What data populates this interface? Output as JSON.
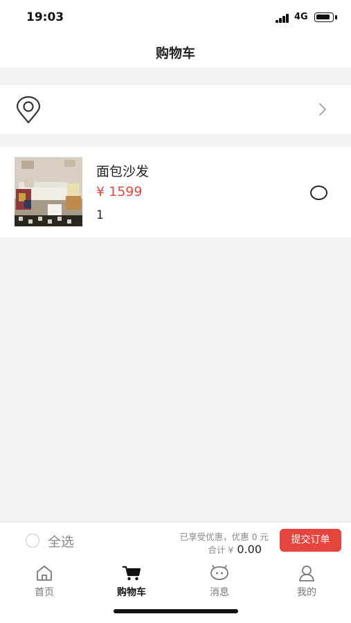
{
  "status_bar": {
    "time": "19:03",
    "network": "4G"
  },
  "nav": {
    "title": "购物车"
  },
  "address": {},
  "cart": {
    "items": [
      {
        "name": "面包沙发",
        "price": "¥ 1599",
        "quantity": "1"
      }
    ]
  },
  "footer": {
    "select_all_label": "全选",
    "discount_text": "已享受优惠，优惠 0 元",
    "total_label": "合计 ¥",
    "total_value": "0.00",
    "submit_label": "提交订单"
  },
  "tabs": [
    {
      "label": "首页",
      "icon": "home-icon"
    },
    {
      "label": "购物车",
      "icon": "cart-icon",
      "active": true
    },
    {
      "label": "消息",
      "icon": "message-icon"
    },
    {
      "label": "我的",
      "icon": "profile-icon"
    }
  ],
  "colors": {
    "accent": "#e4463f",
    "background": "#f2f2f5",
    "card": "#ffffff"
  }
}
